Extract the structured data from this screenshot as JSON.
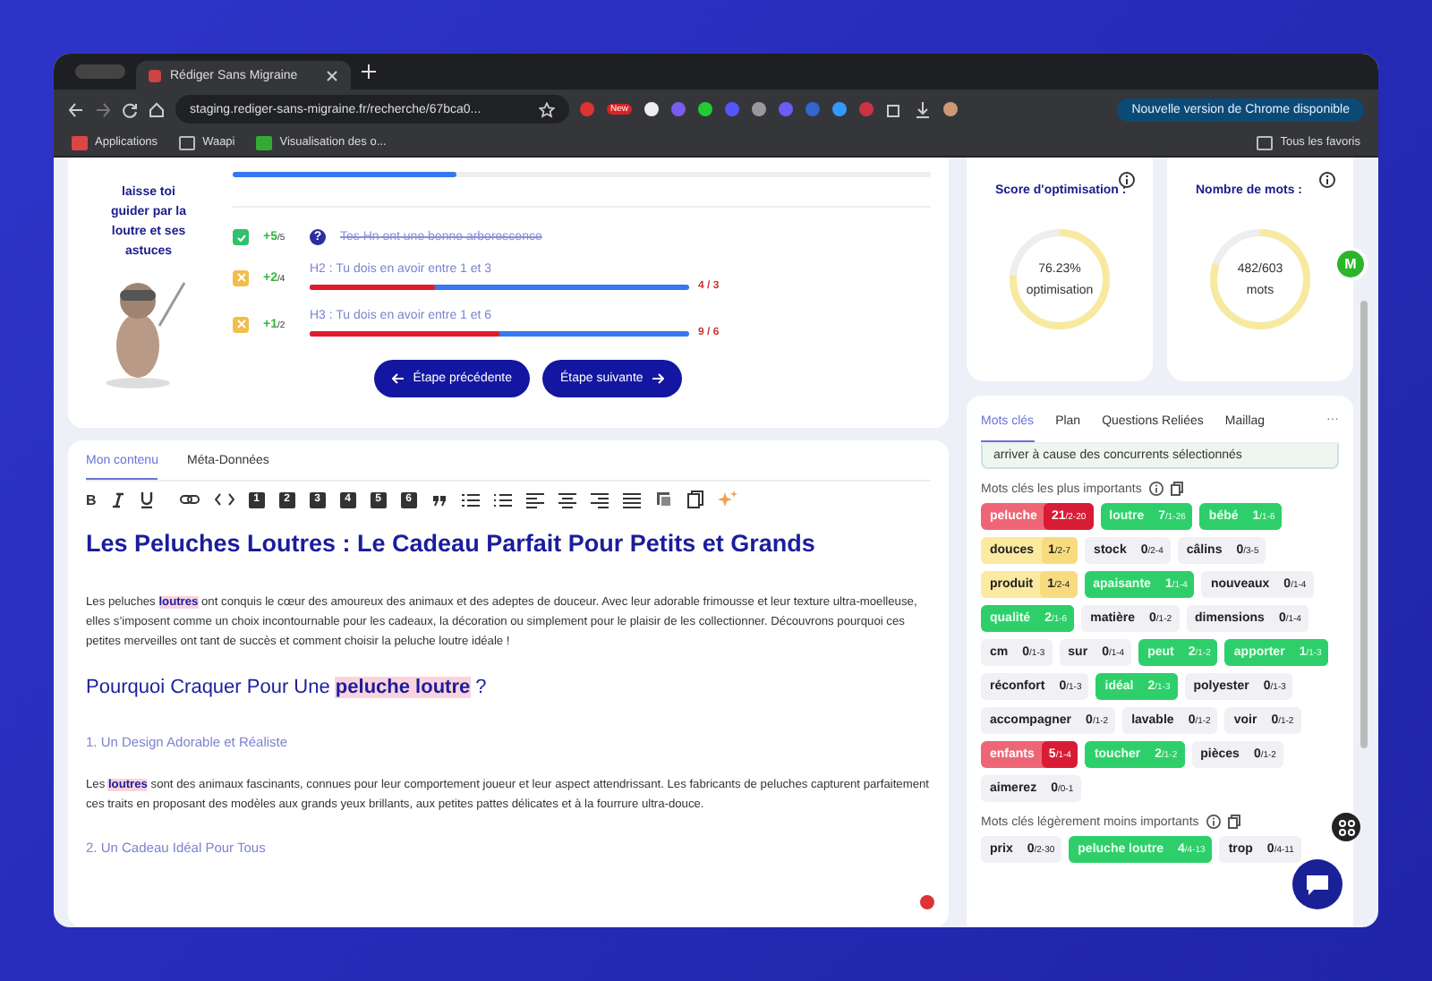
{
  "browser": {
    "tab_title": "Rédiger Sans Migraine",
    "url": "staging.rediger-sans-migraine.fr/recherche/67bca0...",
    "extension_badge": "New",
    "update_button": "Nouvelle version de Chrome disponible",
    "bookmarks": [
      "Applications",
      "Waapi",
      "Visualisation des o..."
    ],
    "all_bookmarks": "Tous les favoris"
  },
  "guide": {
    "mascot_text": "laisse toi guider par la loutre et ses astuces",
    "top_progress": {
      "level": 0.32
    },
    "checks": [
      {
        "kind": "done",
        "points": "+5",
        "max": "/5",
        "help": "?",
        "label": "Tes Hn ont une bonne arborescence"
      },
      {
        "kind": "warn",
        "points": "+2",
        "max": "/4",
        "label": "H2 : Tu dois en avoir entre 1 et 3",
        "level": 0.33,
        "count": "4 / 3"
      },
      {
        "kind": "warn",
        "points": "+1",
        "max": "/2",
        "label": "H3 : Tu dois en avoir entre 1 et 6",
        "level": 0.5,
        "count": "9 / 6"
      }
    ],
    "prev_button": "Étape précédente",
    "next_button": "Étape suivante"
  },
  "editor": {
    "tabs": [
      {
        "label": "Mon contenu",
        "selected": true
      },
      {
        "label": "Méta-Données",
        "selected": false
      }
    ],
    "bold_button": "B",
    "heading_buttons": [
      "1",
      "2",
      "3",
      "4",
      "5",
      "6"
    ],
    "blocks": [
      {
        "kind": "h1",
        "text": "Les Peluches Loutres : Le Cadeau Parfait Pour Petits et Grands"
      },
      {
        "kind": "p",
        "text": "Les peluches **loutres** ont conquis le cœur des amoureux des animaux et des adeptes de douceur. Avec leur adorable frimousse et leur texture ultra-moelleuse, elles s’imposent comme un choix incontournable pour les cadeaux, la décoration ou simplement pour le plaisir de les collectionner. Découvrons pourquoi ces petites merveilles ont tant de succès et comment choisir la peluche loutre idéale !"
      },
      {
        "kind": "h2",
        "text": "Pourquoi Craquer Pour Une **peluche loutre** ?"
      },
      {
        "kind": "h3",
        "text": "1. Un Design Adorable et Réaliste"
      },
      {
        "kind": "p",
        "text": "Les **loutres** sont des animaux fascinants, connues pour leur comportement joueur et leur aspect attendrissant. Les fabricants de peluches capturent parfaitement ces traits en proposant des modèles aux grands yeux brillants, aux petites pattes délicates et à la fourrure ultra-douce."
      },
      {
        "kind": "h3",
        "text": "2. Un Cadeau Idéal Pour Tous"
      }
    ]
  },
  "scores": [
    {
      "title": "Score d'optimisation :",
      "value": "76.23%",
      "unit": "optimisation",
      "level": 0.7623
    },
    {
      "title": "Nombre de mots :",
      "value": "482/603",
      "unit": "mots",
      "level": 0.8
    }
  ],
  "avatar": "M",
  "keywords": {
    "tabs": [
      {
        "label": "Mots clés",
        "selected": true
      },
      {
        "label": "Plan",
        "selected": false
      },
      {
        "label": "Questions Reliées",
        "selected": false
      },
      {
        "label": "Maillag",
        "selected": false
      }
    ],
    "more": "···",
    "notice": "arriver à cause des concurrents sélectionnés",
    "groups": [
      {
        "title": "Mots clés les plus importants",
        "items": [
          {
            "word": "peluche",
            "count": "21",
            "range": "/2-20",
            "kind": "over"
          },
          {
            "word": "loutre",
            "count": "7",
            "range": "/1-26",
            "kind": "ok"
          },
          {
            "word": "bébé",
            "count": "1",
            "range": "/1-6",
            "kind": "ok"
          },
          {
            "word": "douces",
            "count": "1",
            "range": "/2-7",
            "kind": "under"
          },
          {
            "word": "stock",
            "count": "0",
            "range": "/2-4",
            "kind": "missing"
          },
          {
            "word": "câlins",
            "count": "0",
            "range": "/3-5",
            "kind": "missing"
          },
          {
            "word": "produit",
            "count": "1",
            "range": "/2-4",
            "kind": "under"
          },
          {
            "word": "apaisante",
            "count": "1",
            "range": "/1-4",
            "kind": "ok"
          },
          {
            "word": "nouveaux",
            "count": "0",
            "range": "/1-4",
            "kind": "missing"
          },
          {
            "word": "qualité",
            "count": "2",
            "range": "/1-6",
            "kind": "ok"
          },
          {
            "word": "matière",
            "count": "0",
            "range": "/1-2",
            "kind": "missing"
          },
          {
            "word": "dimensions",
            "count": "0",
            "range": "/1-4",
            "kind": "missing"
          },
          {
            "word": "cm",
            "count": "0",
            "range": "/1-3",
            "kind": "missing"
          },
          {
            "word": "sur",
            "count": "0",
            "range": "/1-4",
            "kind": "missing"
          },
          {
            "word": "peut",
            "count": "2",
            "range": "/1-2",
            "kind": "ok"
          },
          {
            "word": "apporter",
            "count": "1",
            "range": "/1-3",
            "kind": "ok"
          },
          {
            "word": "réconfort",
            "count": "0",
            "range": "/1-3",
            "kind": "missing"
          },
          {
            "word": "idéal",
            "count": "2",
            "range": "/1-3",
            "kind": "ok"
          },
          {
            "word": "polyester",
            "count": "0",
            "range": "/1-3",
            "kind": "missing"
          },
          {
            "word": "accompagner",
            "count": "0",
            "range": "/1-2",
            "kind": "missing"
          },
          {
            "word": "lavable",
            "count": "0",
            "range": "/1-2",
            "kind": "missing"
          },
          {
            "word": "voir",
            "count": "0",
            "range": "/1-2",
            "kind": "missing"
          },
          {
            "word": "enfants",
            "count": "5",
            "range": "/1-4",
            "kind": "over"
          },
          {
            "word": "toucher",
            "count": "2",
            "range": "/1-2",
            "kind": "ok"
          },
          {
            "word": "pièces",
            "count": "0",
            "range": "/1-2",
            "kind": "missing"
          },
          {
            "word": "aimerez",
            "count": "0",
            "range": "/0-1",
            "kind": "missing"
          }
        ]
      },
      {
        "title": "Mots clés légèrement moins importants",
        "items": [
          {
            "word": "prix",
            "count": "0",
            "range": "/2-30",
            "kind": "missing"
          },
          {
            "word": "peluche loutre",
            "count": "4",
            "range": "/4-13",
            "kind": "ok"
          },
          {
            "word": "trop",
            "count": "0",
            "range": "/4-11",
            "kind": "missing"
          }
        ]
      }
    ]
  }
}
